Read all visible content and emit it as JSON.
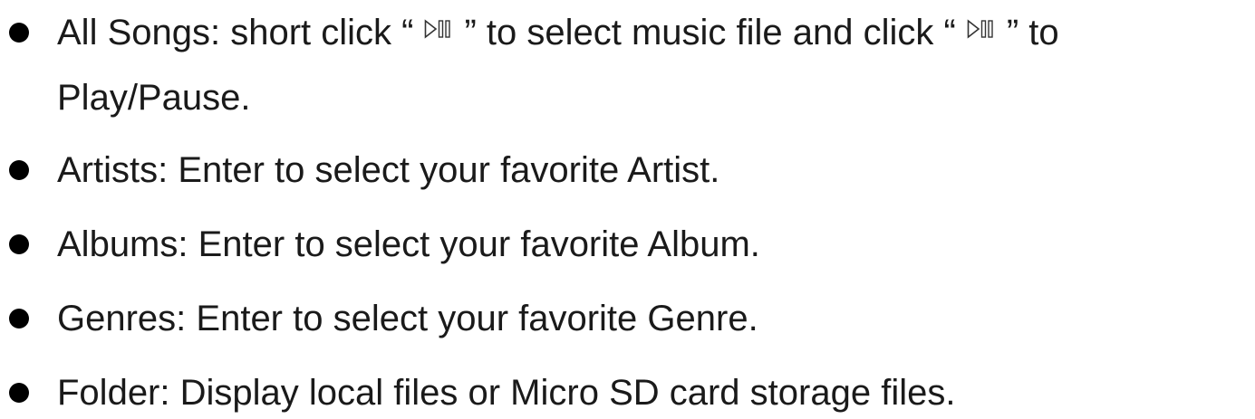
{
  "items": [
    {
      "prefix": "All Songs: short click “",
      "middle": "” to select music file and click “",
      "suffix": "” to",
      "continuation": "Play/Pause.",
      "icon": "play-pause-icon"
    },
    {
      "text": "Artists: Enter to select your favorite Artist."
    },
    {
      "text": "Albums: Enter to select your favorite Album."
    },
    {
      "text": "Genres: Enter to select your favorite Genre."
    },
    {
      "text": "Folder: Display local files or Micro SD card storage files."
    }
  ]
}
